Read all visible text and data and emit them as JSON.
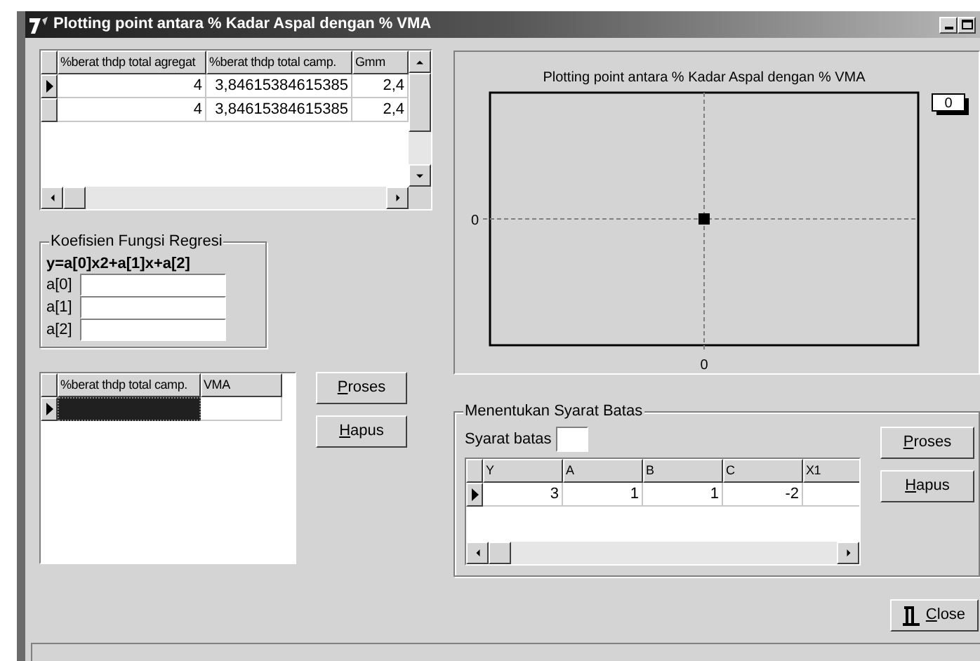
{
  "window": {
    "title": "Plotting point antara % Kadar Aspal dengan % VMA"
  },
  "data_table": {
    "columns": [
      "%berat thdp total agregat",
      "%berat thdp total camp.",
      "Gmm"
    ],
    "rows": [
      {
        "selected": true,
        "cells": [
          "4",
          "3,84615384615385",
          "2,4"
        ]
      },
      {
        "selected": false,
        "cells": [
          "4",
          "3,84615384615385",
          "2,4"
        ]
      }
    ]
  },
  "regression_group": {
    "title": "Koefisien Fungsi Regresi",
    "formula": "y=a[0]x2+a[1]x+a[2]",
    "fields": [
      {
        "label": "a[0]"
      },
      {
        "label": "a[1]"
      },
      {
        "label": "a[2]"
      }
    ]
  },
  "vma_table": {
    "columns": [
      "%berat thdp total camp.",
      "VMA"
    ],
    "rows": [
      {
        "selected": true,
        "editing": true
      }
    ]
  },
  "left_buttons": [
    {
      "label": "Proses"
    },
    {
      "label": "Hapus"
    }
  ],
  "chart": {
    "title": "Plotting point antara % Kadar Aspal dengan % VMA",
    "y_axis_label": "0",
    "x_axis_label": "0",
    "legend": "0"
  },
  "limits_group": {
    "title": "Menentukan Syarat Batas",
    "field_label": "Syarat batas",
    "table": {
      "columns": [
        "Y",
        "A",
        "B",
        "C",
        "X1"
      ],
      "rows": [
        {
          "selected": true,
          "cells": [
            "3",
            "1",
            "1",
            "-2"
          ]
        }
      ]
    },
    "buttons": [
      {
        "label": "Proses"
      },
      {
        "label": "Hapus"
      }
    ]
  },
  "close_button": {
    "label": "Close"
  }
}
